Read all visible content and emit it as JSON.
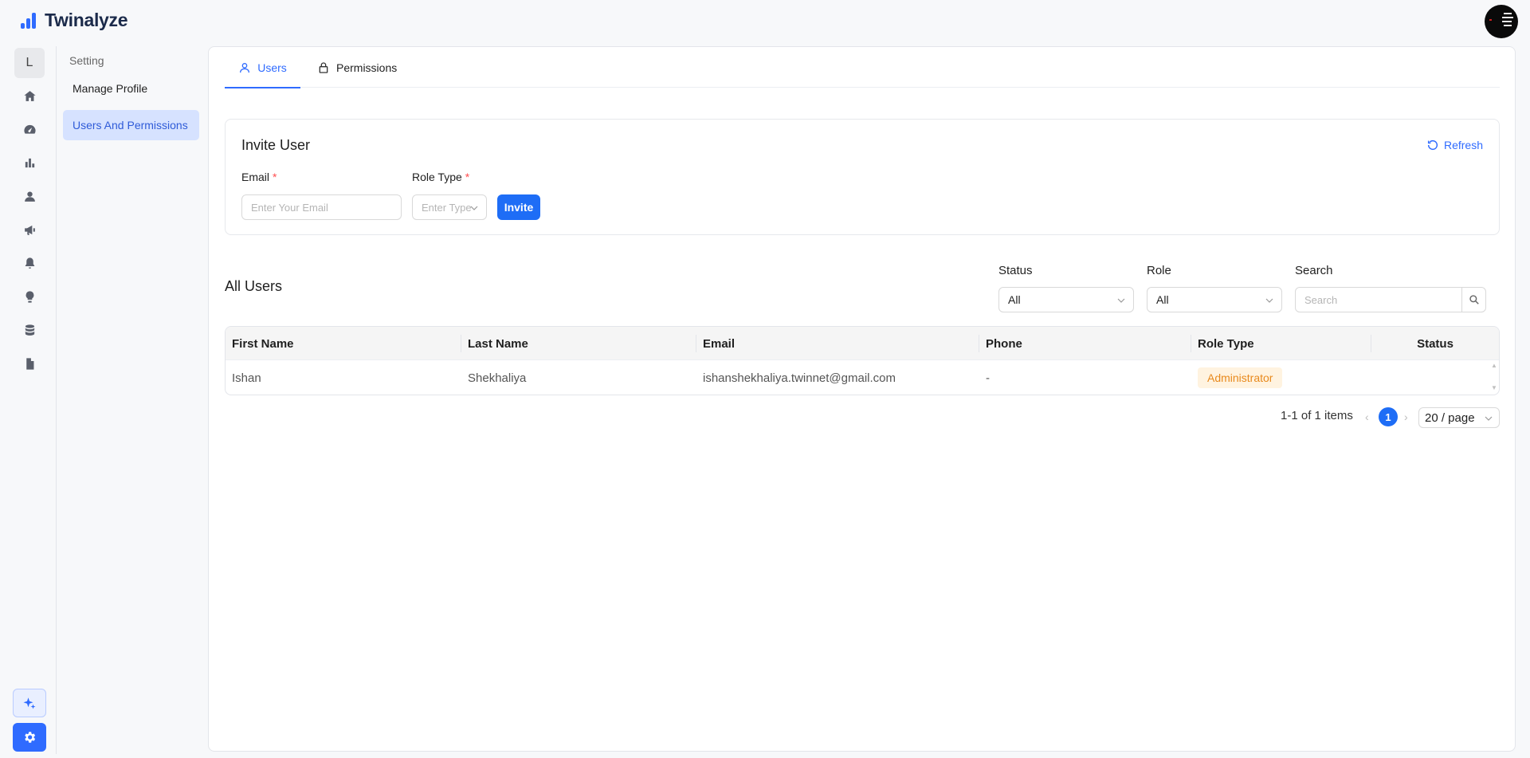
{
  "app": {
    "name": "Twinalyze"
  },
  "rail": {
    "workspace_letter": "L"
  },
  "subnav": {
    "title": "Setting",
    "items": [
      {
        "label": "Manage Profile",
        "active": false
      },
      {
        "label": "Users And Permissions",
        "active": true
      }
    ]
  },
  "tabs": [
    {
      "label": "Users",
      "active": true
    },
    {
      "label": "Permissions",
      "active": false
    }
  ],
  "invite": {
    "title": "Invite User",
    "refresh_label": "Refresh",
    "email_label": "Email",
    "email_placeholder": "Enter Your Email",
    "role_label": "Role Type",
    "role_placeholder": "Enter Type",
    "required_mark": "*",
    "invite_label": "Invite"
  },
  "users": {
    "title": "All Users",
    "filters": {
      "status_label": "Status",
      "status_value": "All",
      "role_label": "Role",
      "role_value": "All",
      "search_label": "Search",
      "search_placeholder": "Search"
    },
    "columns": [
      "First Name",
      "Last Name",
      "Email",
      "Phone",
      "Role Type",
      "Status"
    ],
    "rows": [
      {
        "first_name": "Ishan",
        "last_name": "Shekhaliya",
        "email": "ishanshekhaliya.twinnet@gmail.com",
        "phone": "-",
        "role_type": "Administrator",
        "status": ""
      }
    ]
  },
  "pagination": {
    "summary": "1-1 of 1 items",
    "current_page": "1",
    "page_size": "20 / page"
  },
  "colors": {
    "accent": "#2f6bff",
    "primary_button": "#1e6df6",
    "role_tag_bg": "#fff3e0",
    "role_tag_text": "#e8891c",
    "active_nav_bg": "#d6e2ff"
  }
}
